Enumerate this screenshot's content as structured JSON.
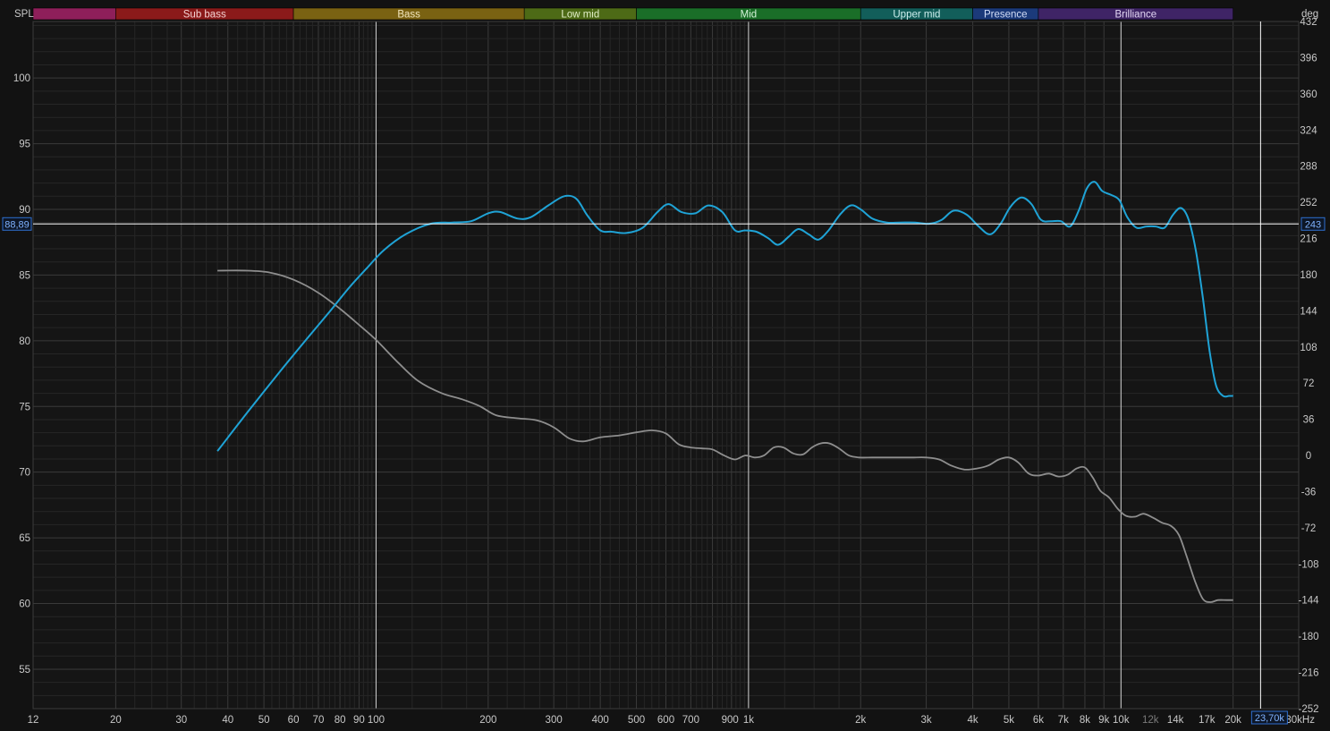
{
  "colors": {
    "background": "#121212",
    "plot_background": "#151515",
    "grid_major": "#3a3a3a",
    "grid_minor": "#262626",
    "decade_line": "#cfcfcf",
    "axis_text": "#c8c8c8",
    "magnitude_trace": "#1fa3d6",
    "phase_trace": "#8e8e8e",
    "cursor": "#ffffff",
    "cursor_readout_border": "#2e6fd0",
    "cursor_readout_text": "#7fb2ff"
  },
  "axis_titles": {
    "left": "SPL",
    "right": "deg"
  },
  "bands": [
    {
      "label": "",
      "from": 12,
      "to": 20,
      "color": "#8e1f5a",
      "text": "#f0d0e0"
    },
    {
      "label": "Sub bass",
      "from": 20,
      "to": 60,
      "color": "#8b1a1a",
      "text": "#f3d2d2"
    },
    {
      "label": "Bass",
      "from": 60,
      "to": 250,
      "color": "#7a6212",
      "text": "#f2e6be"
    },
    {
      "label": "Low mid",
      "from": 250,
      "to": 500,
      "color": "#4d6a16",
      "text": "#e2f0c8"
    },
    {
      "label": "Mid",
      "from": 500,
      "to": 2000,
      "color": "#1a6e28",
      "text": "#d4f2d8"
    },
    {
      "label": "Upper mid",
      "from": 2000,
      "to": 4000,
      "color": "#125e5a",
      "text": "#cdeeed"
    },
    {
      "label": "Presence",
      "from": 4000,
      "to": 6000,
      "color": "#1b3a7a",
      "text": "#d3def7"
    },
    {
      "label": "Brilliance",
      "from": 6000,
      "to": 20000,
      "color": "#3f2466",
      "text": "#e2d6f3"
    }
  ],
  "cursor": {
    "spl_label": "88,89",
    "deg_label": "243",
    "freq_label": "23,70k"
  },
  "chart_data": {
    "type": "line",
    "x_scale": "log",
    "xlim": [
      12,
      30000
    ],
    "ylim_left": [
      52,
      104.3
    ],
    "ylim_right": [
      -252,
      432
    ],
    "grid": true,
    "x_tick_labels": [
      {
        "f": 12,
        "label": "12"
      },
      {
        "f": 20,
        "label": "20"
      },
      {
        "f": 30,
        "label": "30"
      },
      {
        "f": 40,
        "label": "40"
      },
      {
        "f": 50,
        "label": "50"
      },
      {
        "f": 60,
        "label": "60"
      },
      {
        "f": 70,
        "label": "70"
      },
      {
        "f": 80,
        "label": "80"
      },
      {
        "f": 90,
        "label": "90"
      },
      {
        "f": 100,
        "label": "100"
      },
      {
        "f": 200,
        "label": "200"
      },
      {
        "f": 300,
        "label": "300"
      },
      {
        "f": 400,
        "label": "400"
      },
      {
        "f": 500,
        "label": "500"
      },
      {
        "f": 600,
        "label": "600"
      },
      {
        "f": 700,
        "label": "700"
      },
      {
        "f": 900,
        "label": "900"
      },
      {
        "f": 1000,
        "label": "1k"
      },
      {
        "f": 2000,
        "label": "2k"
      },
      {
        "f": 3000,
        "label": "3k"
      },
      {
        "f": 4000,
        "label": "4k"
      },
      {
        "f": 5000,
        "label": "5k"
      },
      {
        "f": 6000,
        "label": "6k"
      },
      {
        "f": 7000,
        "label": "7k"
      },
      {
        "f": 8000,
        "label": "8k"
      },
      {
        "f": 9000,
        "label": "9k"
      },
      {
        "f": 10000,
        "label": "10k"
      },
      {
        "f": 12000,
        "label": "12k",
        "dim": true
      },
      {
        "f": 14000,
        "label": "14k"
      },
      {
        "f": 17000,
        "label": "17k"
      },
      {
        "f": 20000,
        "label": "20k"
      },
      {
        "f": 30000,
        "label": "30kHz"
      }
    ],
    "left_ticks": [
      {
        "v": 100,
        "label": "100"
      },
      {
        "v": 95,
        "label": "95"
      },
      {
        "v": 90,
        "label": "90"
      },
      {
        "v": 85,
        "label": "85"
      },
      {
        "v": 80,
        "label": "80"
      },
      {
        "v": 75,
        "label": "75"
      },
      {
        "v": 70,
        "label": "70"
      },
      {
        "v": 65,
        "label": "65"
      },
      {
        "v": 60,
        "label": "60"
      },
      {
        "v": 55,
        "label": "55"
      }
    ],
    "right_ticks": [
      {
        "v": 432,
        "label": "432"
      },
      {
        "v": 396,
        "label": "396"
      },
      {
        "v": 360,
        "label": "360"
      },
      {
        "v": 324,
        "label": "324"
      },
      {
        "v": 288,
        "label": "288"
      },
      {
        "v": 252,
        "label": "252"
      },
      {
        "v": 216,
        "label": "216"
      },
      {
        "v": 180,
        "label": "180"
      },
      {
        "v": 144,
        "label": "144"
      },
      {
        "v": 108,
        "label": "108"
      },
      {
        "v": 72,
        "label": "72"
      },
      {
        "v": 36,
        "label": "36"
      },
      {
        "v": 0,
        "label": "0"
      },
      {
        "v": -36,
        "label": "-36"
      },
      {
        "v": -72,
        "label": "-72"
      },
      {
        "v": -108,
        "label": "-108"
      },
      {
        "v": -144,
        "label": "-144"
      },
      {
        "v": -180,
        "label": "-180"
      },
      {
        "v": -216,
        "label": "-216"
      },
      {
        "v": -252,
        "label": "-252"
      }
    ],
    "cursor_x": 23700,
    "cursor_y": 88.89,
    "series": [
      {
        "key": "magnitude",
        "axis": "left",
        "points": [
          [
            37.5,
            71.6
          ],
          [
            45,
            74.5
          ],
          [
            55,
            77.6
          ],
          [
            65,
            80.1
          ],
          [
            75,
            82.2
          ],
          [
            85,
            84.1
          ],
          [
            95,
            85.6
          ],
          [
            105,
            86.9
          ],
          [
            120,
            88.1
          ],
          [
            140,
            88.9
          ],
          [
            160,
            89.0
          ],
          [
            180,
            89.1
          ],
          [
            200,
            89.7
          ],
          [
            215,
            89.8
          ],
          [
            240,
            89.3
          ],
          [
            260,
            89.4
          ],
          [
            290,
            90.3
          ],
          [
            320,
            91.0
          ],
          [
            345,
            90.8
          ],
          [
            370,
            89.5
          ],
          [
            400,
            88.4
          ],
          [
            430,
            88.3
          ],
          [
            470,
            88.2
          ],
          [
            520,
            88.6
          ],
          [
            570,
            89.8
          ],
          [
            610,
            90.4
          ],
          [
            660,
            89.8
          ],
          [
            720,
            89.7
          ],
          [
            780,
            90.3
          ],
          [
            850,
            89.8
          ],
          [
            920,
            88.4
          ],
          [
            980,
            88.4
          ],
          [
            1050,
            88.3
          ],
          [
            1130,
            87.8
          ],
          [
            1200,
            87.3
          ],
          [
            1280,
            87.9
          ],
          [
            1360,
            88.5
          ],
          [
            1450,
            88.1
          ],
          [
            1540,
            87.7
          ],
          [
            1640,
            88.4
          ],
          [
            1760,
            89.6
          ],
          [
            1880,
            90.3
          ],
          [
            2000,
            90.0
          ],
          [
            2150,
            89.3
          ],
          [
            2350,
            89.0
          ],
          [
            2550,
            89.0
          ],
          [
            2800,
            89.0
          ],
          [
            3050,
            88.9
          ],
          [
            3300,
            89.2
          ],
          [
            3550,
            89.9
          ],
          [
            3850,
            89.6
          ],
          [
            4150,
            88.7
          ],
          [
            4450,
            88.1
          ],
          [
            4750,
            88.9
          ],
          [
            5050,
            90.2
          ],
          [
            5400,
            90.9
          ],
          [
            5750,
            90.4
          ],
          [
            6100,
            89.2
          ],
          [
            6500,
            89.1
          ],
          [
            6900,
            89.1
          ],
          [
            7300,
            88.7
          ],
          [
            7700,
            89.9
          ],
          [
            8100,
            91.6
          ],
          [
            8500,
            92.1
          ],
          [
            8900,
            91.4
          ],
          [
            9400,
            91.1
          ],
          [
            9900,
            90.7
          ],
          [
            10400,
            89.4
          ],
          [
            11000,
            88.6
          ],
          [
            11700,
            88.7
          ],
          [
            12400,
            88.7
          ],
          [
            13100,
            88.6
          ],
          [
            13800,
            89.6
          ],
          [
            14500,
            90.1
          ],
          [
            15200,
            89.2
          ],
          [
            15900,
            86.8
          ],
          [
            16600,
            83.2
          ],
          [
            17300,
            79.2
          ],
          [
            18000,
            76.6
          ],
          [
            18800,
            75.8
          ],
          [
            19500,
            75.8
          ],
          [
            20000,
            75.8
          ]
        ]
      },
      {
        "key": "phase",
        "axis": "right",
        "points": [
          [
            37.5,
            184
          ],
          [
            45,
            184
          ],
          [
            52,
            182
          ],
          [
            60,
            175
          ],
          [
            70,
            162
          ],
          [
            80,
            146
          ],
          [
            90,
            130
          ],
          [
            100,
            115
          ],
          [
            115,
            92
          ],
          [
            130,
            74
          ],
          [
            150,
            62
          ],
          [
            170,
            56
          ],
          [
            190,
            49
          ],
          [
            210,
            40
          ],
          [
            240,
            37
          ],
          [
            270,
            35
          ],
          [
            300,
            28
          ],
          [
            330,
            17
          ],
          [
            360,
            14
          ],
          [
            400,
            18
          ],
          [
            450,
            20
          ],
          [
            500,
            23
          ],
          [
            550,
            25
          ],
          [
            600,
            22
          ],
          [
            650,
            11
          ],
          [
            700,
            8
          ],
          [
            750,
            7
          ],
          [
            800,
            6
          ],
          [
            860,
            0
          ],
          [
            920,
            -4
          ],
          [
            980,
            0
          ],
          [
            1040,
            -2
          ],
          [
            1100,
            0
          ],
          [
            1170,
            8
          ],
          [
            1240,
            8
          ],
          [
            1320,
            2
          ],
          [
            1400,
            1
          ],
          [
            1480,
            8
          ],
          [
            1560,
            12
          ],
          [
            1650,
            12
          ],
          [
            1750,
            7
          ],
          [
            1860,
            0
          ],
          [
            1980,
            -2
          ],
          [
            2150,
            -2
          ],
          [
            2350,
            -2
          ],
          [
            2550,
            -2
          ],
          [
            2750,
            -2
          ],
          [
            3000,
            -2
          ],
          [
            3250,
            -4
          ],
          [
            3500,
            -10
          ],
          [
            3800,
            -14
          ],
          [
            4100,
            -13
          ],
          [
            4400,
            -10
          ],
          [
            4700,
            -4
          ],
          [
            5000,
            -2
          ],
          [
            5300,
            -7
          ],
          [
            5650,
            -18
          ],
          [
            6000,
            -20
          ],
          [
            6400,
            -18
          ],
          [
            6800,
            -21
          ],
          [
            7200,
            -19
          ],
          [
            7600,
            -13
          ],
          [
            8000,
            -12
          ],
          [
            8400,
            -22
          ],
          [
            8800,
            -35
          ],
          [
            9300,
            -42
          ],
          [
            9800,
            -53
          ],
          [
            10300,
            -60
          ],
          [
            10900,
            -61
          ],
          [
            11500,
            -58
          ],
          [
            12200,
            -62
          ],
          [
            12900,
            -67
          ],
          [
            13600,
            -70
          ],
          [
            14300,
            -79
          ],
          [
            15000,
            -100
          ],
          [
            15800,
            -125
          ],
          [
            16600,
            -143
          ],
          [
            17400,
            -146
          ],
          [
            18200,
            -144
          ],
          [
            19200,
            -144
          ],
          [
            20000,
            -144
          ]
        ]
      }
    ]
  }
}
